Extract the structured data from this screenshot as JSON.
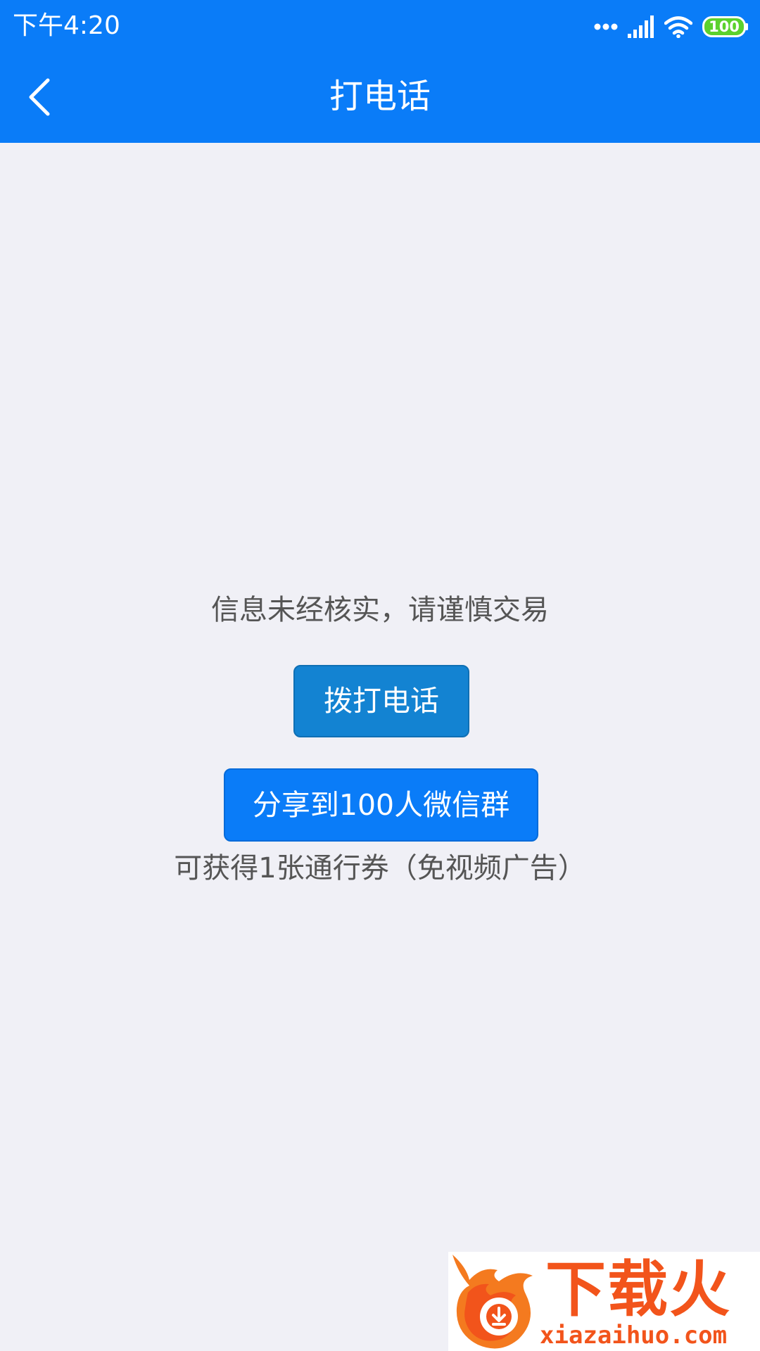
{
  "status_bar": {
    "time": "下午4:20",
    "battery": "100",
    "icons": [
      "dots-icon",
      "signal-icon",
      "wifi-icon",
      "battery-icon"
    ]
  },
  "header": {
    "title": "打电话",
    "back_icon": "chevron-left-icon"
  },
  "content": {
    "warning": "信息未经核实，请谨慎交易",
    "call_button_label": "拨打电话",
    "share_button_label": "分享到100人微信群",
    "reward_text": "可获得1张通行券（免视频广告）"
  },
  "watermark": {
    "brand": "下载火",
    "url": "xiazaihuo.com"
  },
  "colors": {
    "primary": "#0a7cf8",
    "call_button": "#1383d2",
    "background": "#f0f0f6",
    "text": "#555555",
    "watermark": "#f2541b"
  }
}
